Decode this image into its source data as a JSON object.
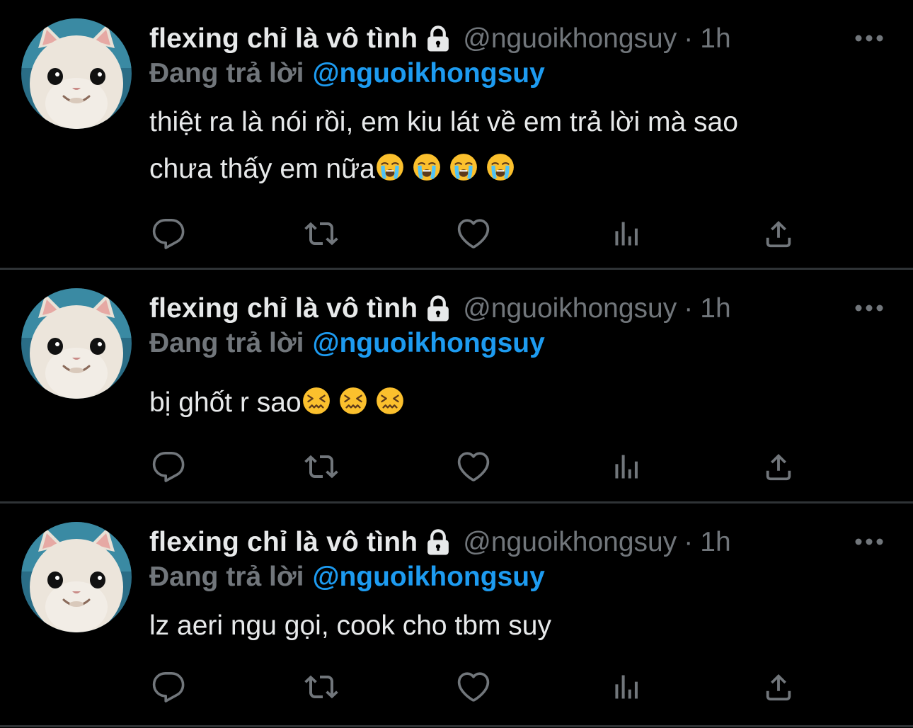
{
  "colors": {
    "background": "#000000",
    "text_primary": "#e7e9ea",
    "text_secondary": "#71767b",
    "accent": "#1d9bf0",
    "divider": "#2f3336"
  },
  "tweets": [
    {
      "display_name": "flexing chỉ là vô tình",
      "handle": "@nguoikhongsuy",
      "separator": "·",
      "time": "1h",
      "reply_prefix": "Đang trả lời",
      "reply_target": "@nguoikhongsuy",
      "text_line1": "thiệt ra là nói rồi, em kiu lát về em trả lời mà sao",
      "text_line2": "chưa thấy em nữa",
      "emoji": "crying-face-emoji",
      "emoji_count": 4
    },
    {
      "display_name": "flexing chỉ là vô tình",
      "handle": "@nguoikhongsuy",
      "separator": "·",
      "time": "1h",
      "reply_prefix": "Đang trả lời",
      "reply_target": "@nguoikhongsuy",
      "text_line1": "bị ghốt r sao",
      "emoji": "confounded-face-emoji",
      "emoji_count": 3
    },
    {
      "display_name": "flexing chỉ là vô tình",
      "handle": "@nguoikhongsuy",
      "separator": "·",
      "time": "1h",
      "reply_prefix": "Đang trả lời",
      "reply_target": "@nguoikhongsuy",
      "text_line1": "lz aeri ngu gọi, cook cho tbm suy"
    }
  ],
  "action_icons": [
    "reply-icon",
    "retweet-icon",
    "like-icon",
    "analytics-icon",
    "share-icon"
  ],
  "header_icons": [
    "lock-icon",
    "more-icon"
  ]
}
